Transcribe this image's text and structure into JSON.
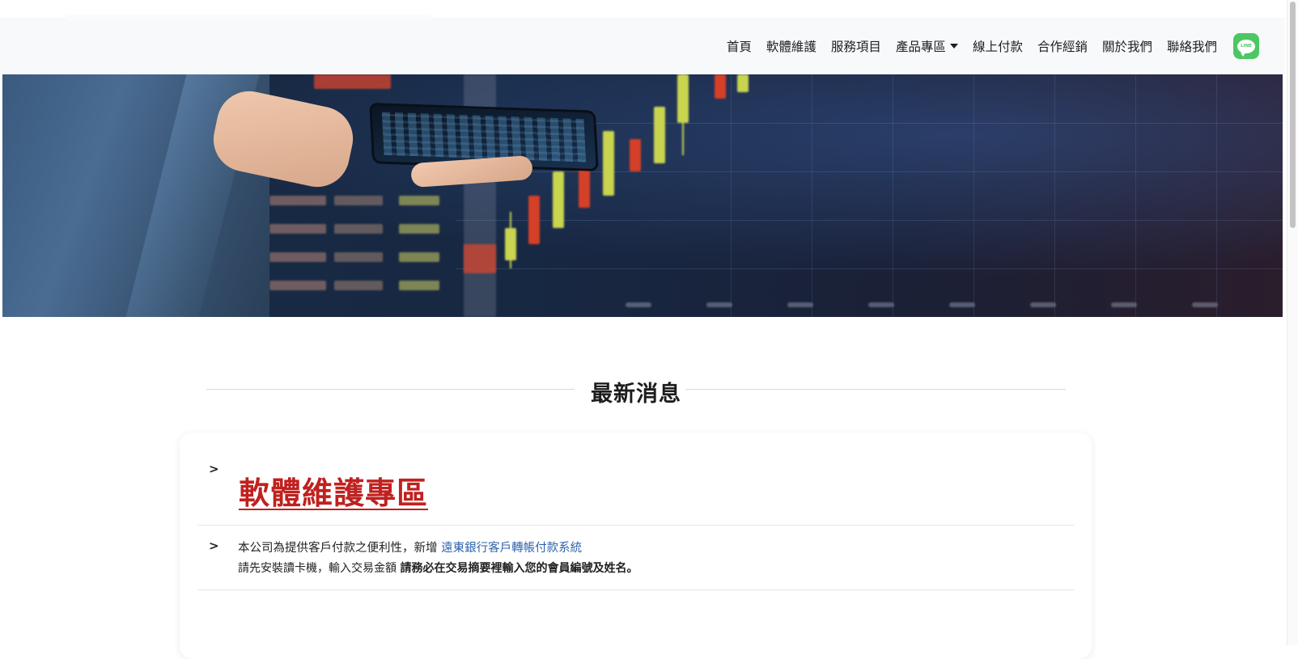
{
  "nav": {
    "items": [
      {
        "label": "首頁"
      },
      {
        "label": "軟體維護"
      },
      {
        "label": "服務項目"
      },
      {
        "label": "產品專區",
        "dropdown": true
      },
      {
        "label": "線上付款"
      },
      {
        "label": "合作經銷"
      },
      {
        "label": "關於我們"
      },
      {
        "label": "聯絡我們"
      }
    ],
    "line_icon_text": "LINE",
    "line_icon_color": "#4cc764"
  },
  "news": {
    "section_title": "最新消息",
    "card_marker": ">",
    "card_title": "軟體維護專區",
    "card_title_color": "#c0211f",
    "item": {
      "marker": ">",
      "line1_prefix": "本公司為提供客戶付款之便利性，新增 ",
      "line1_link": "遠東銀行客戶轉帳付款系統",
      "line2_prefix": "請先安裝讀卡機，輸入交易金額 ",
      "line2_bold": "請務必在交易摘要裡輸入您的會員編號及姓名。"
    },
    "link_color": "#2f62ad"
  }
}
